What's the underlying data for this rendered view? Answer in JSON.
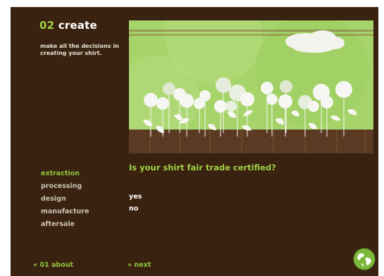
{
  "header": {
    "step_number": "02",
    "step_title": "create",
    "subtitle": "make all the decisions in creating your shirt."
  },
  "nav": {
    "items": [
      {
        "label": "extraction",
        "active": true
      },
      {
        "label": "processing",
        "active": false
      },
      {
        "label": "design",
        "active": false
      },
      {
        "label": "manufacture",
        "active": false
      },
      {
        "label": "aftersale",
        "active": false
      }
    ]
  },
  "question": {
    "text": "Is your shirt fair trade certified?",
    "options": [
      "yes",
      "no"
    ]
  },
  "footer": {
    "prev_arrow": "«",
    "prev_label": "01 about",
    "next_arrow": "»",
    "next_label": "next"
  },
  "icons": {
    "globe": "globe-icon"
  },
  "colors": {
    "background": "#3a2210",
    "accent_green": "#9fd045",
    "sky_green": "#a7d46a",
    "text_light": "#c9c1b3"
  }
}
